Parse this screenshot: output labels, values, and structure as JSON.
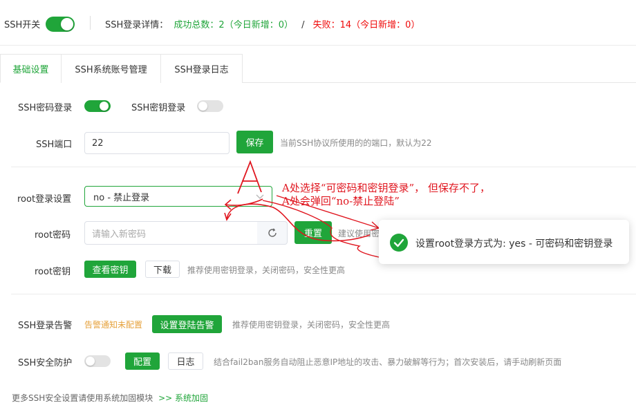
{
  "header": {
    "ssh_switch_label": "SSH开关",
    "ssh_switch_on": true,
    "detail_label": "SSH登录详情：",
    "success_text": "成功总数：2（今日新增：0）",
    "separator": "/",
    "fail_text": "失败：14（今日新增：0）"
  },
  "tabs": [
    {
      "label": "基础设置",
      "active": true
    },
    {
      "label": "SSH系统账号管理",
      "active": false
    },
    {
      "label": "SSH登录日志",
      "active": false
    }
  ],
  "basic": {
    "password_login_label": "SSH密码登录",
    "password_login_on": true,
    "key_login_label": "SSH密钥登录",
    "key_login_on": false,
    "port_label": "SSH端口",
    "port_value": "22",
    "save_button": "保存",
    "port_hint": "当前SSH协议所使用的的端口，默认为22",
    "root_login_label": "root登录设置",
    "root_login_value": "no - 禁止登录",
    "root_password_label": "root密码",
    "root_password_placeholder": "请输入新密码",
    "reset_button": "重置",
    "reset_hint": "建议使用密",
    "root_key_label": "root密钥",
    "view_key_button": "查看密钥",
    "download_button": "下载",
    "root_key_hint": "推荐使用密钥登录，关闭密码，安全性更高",
    "alert_label": "SSH登录告警",
    "alert_warn": "告警通知未配置",
    "alert_button": "设置登陆告警",
    "alert_hint": "推荐使用密钥登录，关闭密码，安全性更高",
    "protect_label": "SSH安全防护",
    "protect_on": false,
    "config_button": "配置",
    "log_button": "日志",
    "protect_hint": "结合fail2ban服务自动阻止恶意IP地址的攻击、暴力破解等行为；首次安装后，请手动刷新页面"
  },
  "footer": {
    "text": "更多SSH安全设置请使用系统加固模块",
    "arrow": ">>",
    "link": "系统加固"
  },
  "toast": {
    "message": "设置root登录方式为: yes - 可密码和密钥登录"
  },
  "annotation": {
    "marker": "A",
    "line1": "A处选择“可密码和密钥登录”，  但保存不了，",
    "line2": "A处会弹回“no-禁止登陆”"
  },
  "colors": {
    "accent": "#20a53a",
    "danger": "#ef0808",
    "warning": "#e6a23c",
    "annotation": "#e0161f"
  }
}
